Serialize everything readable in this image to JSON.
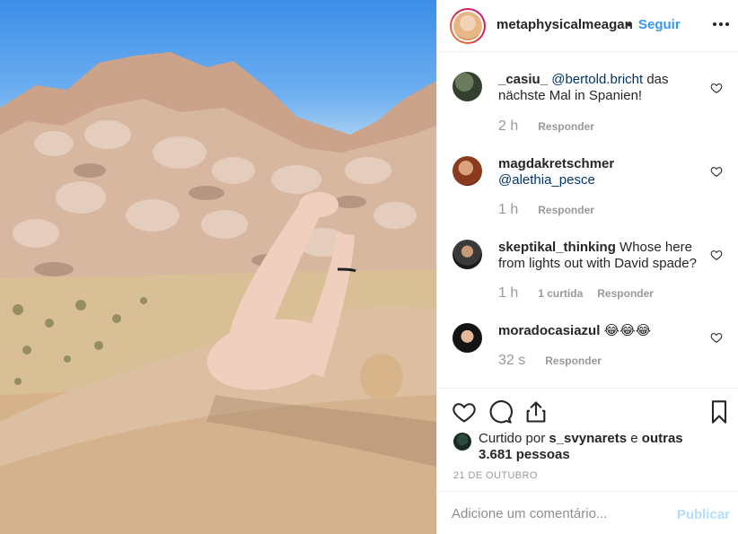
{
  "post": {
    "username": "metaphysicalmeagan",
    "separator": "•",
    "follow_label": "Seguir",
    "more_icon": "more-horizontal-icon"
  },
  "comments": [
    {
      "user": "_casiu_",
      "mention": "@bertold.bricht",
      "text": " das nächste Mal in Spanien!",
      "time": "2 h",
      "likes": "",
      "reply_label": "Responder"
    },
    {
      "user": "magdakretschmer",
      "mention": "@alethia_pesce",
      "text": "",
      "time": "1 h",
      "likes": "",
      "reply_label": "Responder"
    },
    {
      "user": "skeptikal_thinking",
      "mention": "",
      "text": "Whose here from lights out with David spade?",
      "time": "1 h",
      "likes": "1 curtida",
      "reply_label": "Responder"
    },
    {
      "user": "moradocasiazul",
      "mention": "",
      "text": "😂😂😂",
      "time": "32 s",
      "likes": "",
      "reply_label": "Responder"
    }
  ],
  "actions": {
    "like_icon": "heart-icon",
    "comment_icon": "comment-icon",
    "share_icon": "share-icon",
    "save_icon": "bookmark-icon"
  },
  "liked_by": {
    "prefix": "Curtido por",
    "user": "s_svynarets",
    "conj": "e",
    "others": "outras 3.681 pessoas"
  },
  "date": "21 DE OUTUBRO",
  "comment_box": {
    "placeholder": "Adicione um comentário...",
    "publish_label": "Publicar"
  },
  "colors": {
    "link": "#3897f0",
    "mention": "#003569",
    "publish_disabled": "#b2dffc"
  }
}
